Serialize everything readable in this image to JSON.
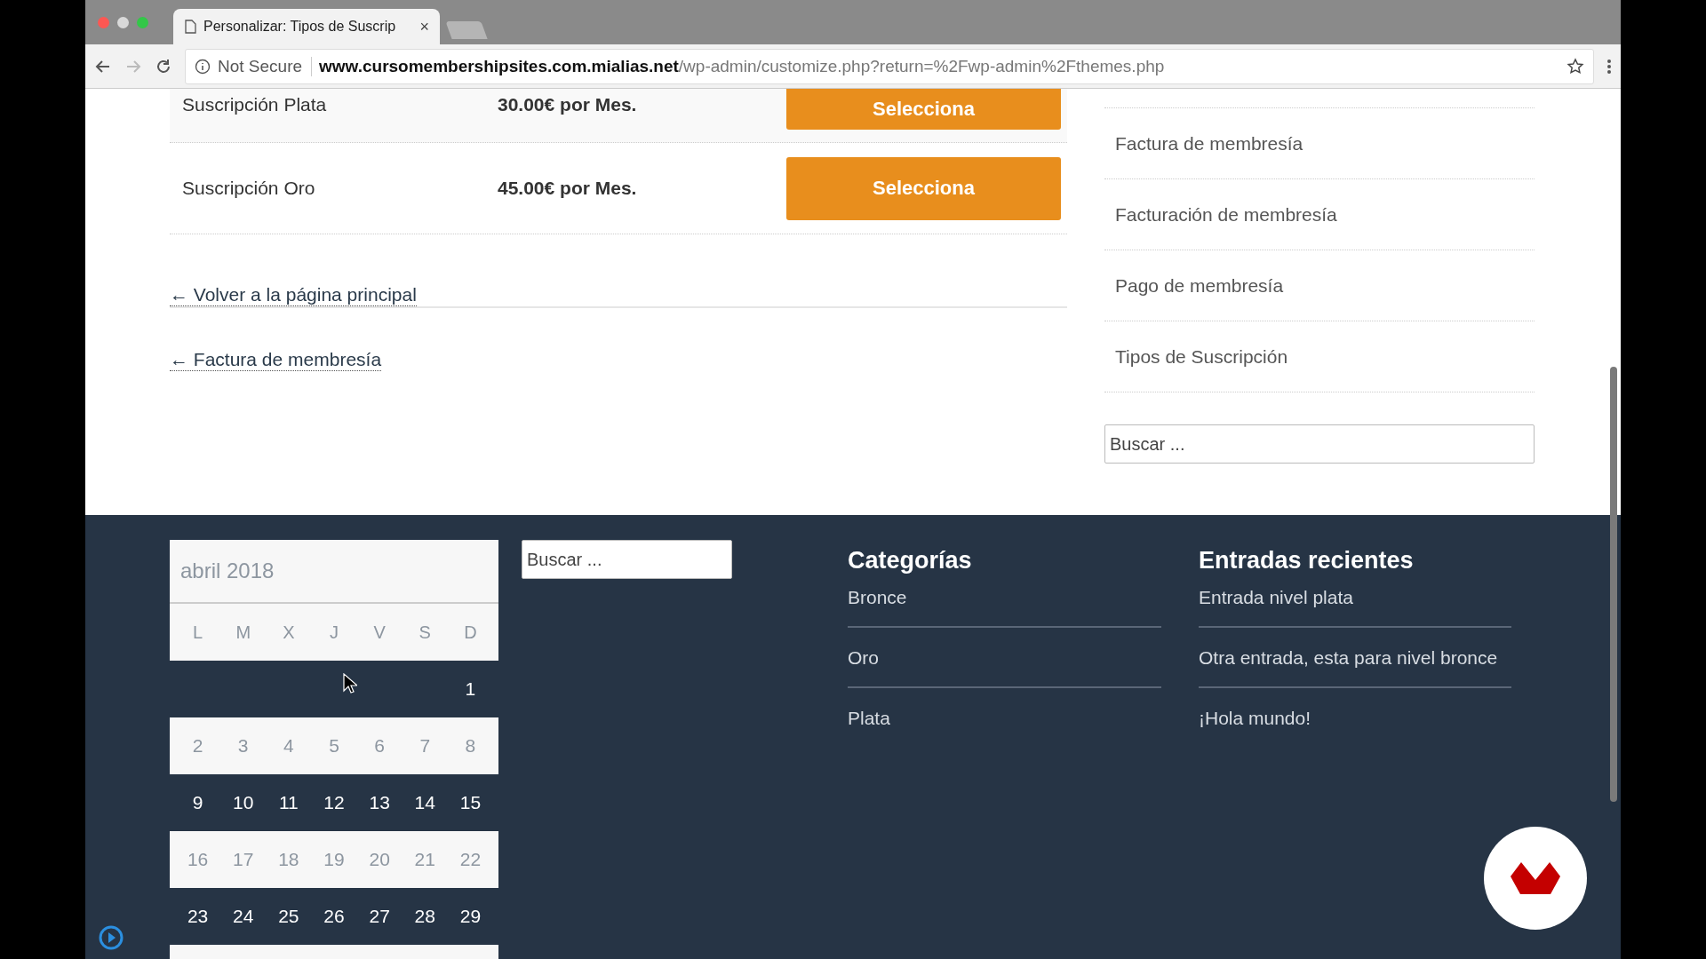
{
  "browser": {
    "tab_title": "Personalizar: Tipos de Suscrip",
    "tab_close": "×",
    "security": "Not Secure",
    "url_domain": "www.cursomembershipsites.com.mialias.net",
    "url_path": "/wp-admin/customize.php?return=%2Fwp-admin%2Fthemes.php"
  },
  "plans": [
    {
      "name": "Suscripción Plata",
      "price": "30.00€ por Mes.",
      "button": "Selecciona"
    },
    {
      "name": "Suscripción Oro",
      "price": "45.00€ por Mes.",
      "button": "Selecciona"
    }
  ],
  "post_nav": [
    "← Volver a la página principal",
    "← Factura de membresía"
  ],
  "sidebar": {
    "items": [
      "Factura de membresía",
      "Facturación de membresía",
      "Pago de membresía",
      "Tipos de Suscripción"
    ],
    "search": {
      "placeholder": "Buscar ..."
    }
  },
  "footer": {
    "calendar": {
      "caption": "abril 2018",
      "weekdays": [
        "L",
        "M",
        "X",
        "J",
        "V",
        "S",
        "D"
      ],
      "weeks": [
        [
          "1"
        ],
        [
          "2",
          "3",
          "4",
          "5",
          "6",
          "7",
          "8"
        ],
        [
          "9",
          "10",
          "11",
          "12",
          "13",
          "14",
          "15"
        ],
        [
          "16",
          "17",
          "18",
          "19",
          "20",
          "21",
          "22"
        ],
        [
          "23",
          "24",
          "25",
          "26",
          "27",
          "28",
          "29"
        ]
      ]
    },
    "search": {
      "placeholder": "Buscar ..."
    },
    "categories": {
      "title": "Categorías",
      "items": [
        "Bronce",
        "Oro",
        "Plata"
      ]
    },
    "recent": {
      "title": "Entradas recientes",
      "items": [
        "Entrada nivel plata",
        "Otra entrada, esta para nivel bronce",
        "¡Hola mundo!"
      ]
    }
  }
}
